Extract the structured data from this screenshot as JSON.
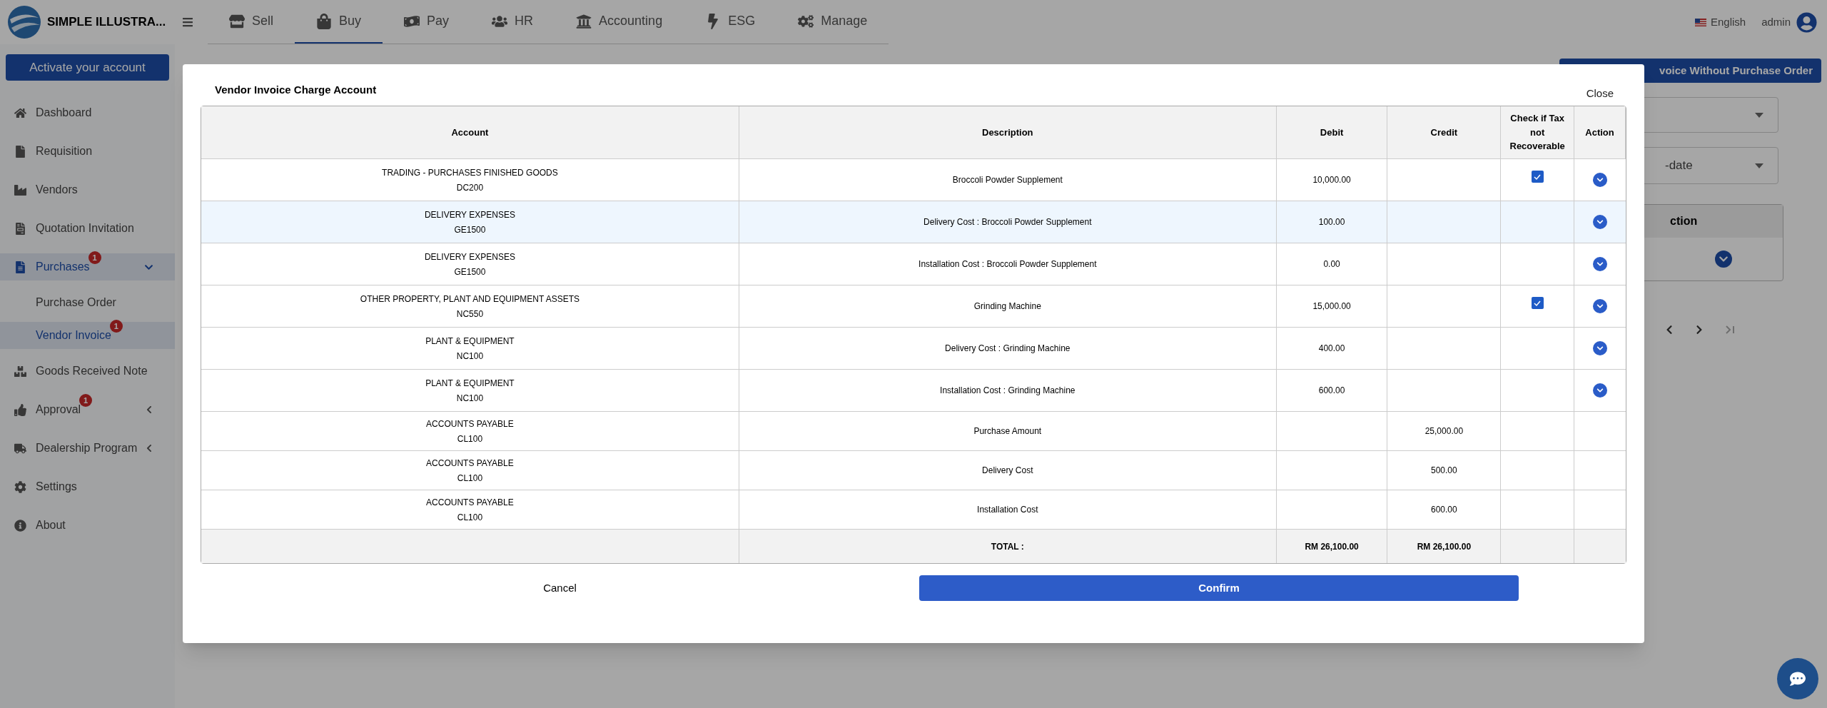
{
  "header": {
    "brand": "SIMPLE ILLUSTRA...",
    "nav_tabs": [
      {
        "label": "Sell",
        "selected": false
      },
      {
        "label": "Buy",
        "selected": true
      },
      {
        "label": "Pay",
        "selected": false
      },
      {
        "label": "HR",
        "selected": false
      },
      {
        "label": "Accounting",
        "selected": false
      },
      {
        "label": "ESG",
        "selected": false
      },
      {
        "label": "Manage",
        "selected": false
      }
    ],
    "language": "English",
    "user": "admin"
  },
  "sidebar": {
    "activate_button": "Activate your account",
    "items": [
      {
        "label": "Dashboard",
        "selected": false
      },
      {
        "label": "Requisition",
        "selected": false
      },
      {
        "label": "Vendors",
        "selected": false
      },
      {
        "label": "Quotation Invitation",
        "selected": false
      },
      {
        "label": "Purchases",
        "selected": true,
        "badge": "1",
        "expanded": true,
        "children": [
          {
            "label": "Purchase Order",
            "selected": false
          },
          {
            "label": "Vendor Invoice",
            "selected": true,
            "badge": "1"
          }
        ]
      },
      {
        "label": "Goods Received Note",
        "selected": false
      },
      {
        "label": "Approval",
        "selected": false,
        "badge": "1",
        "expanded": false
      },
      {
        "label": "Dealership Program",
        "selected": false,
        "expanded": false
      },
      {
        "label": "Settings",
        "selected": false
      },
      {
        "label": "About",
        "selected": false
      }
    ]
  },
  "background": {
    "primary_button": "voice Without Purchase Order",
    "select_2_value": "-date",
    "table_header": "ction"
  },
  "modal": {
    "title": "Vendor Invoice Charge Account",
    "close": "Close",
    "columns": [
      "Account",
      "Description",
      "Debit",
      "Credit",
      "Check if Tax not Recoverable",
      "Action"
    ],
    "rows": [
      {
        "account": "TRADING - PURCHASES FINISHED GOODS",
        "code": "DC200",
        "description": "Broccoli Powder Supplement",
        "debit": "10,000.00",
        "credit": "",
        "tax_not_recoverable": true,
        "highlighted": false,
        "has_action": true
      },
      {
        "account": "DELIVERY EXPENSES",
        "code": "GE1500",
        "description": "Delivery Cost : Broccoli Powder Supplement",
        "debit": "100.00",
        "credit": "",
        "tax_not_recoverable": false,
        "highlighted": true,
        "has_action": true
      },
      {
        "account": "DELIVERY EXPENSES",
        "code": "GE1500",
        "description": "Installation Cost : Broccoli Powder Supplement",
        "debit": "0.00",
        "credit": "",
        "tax_not_recoverable": false,
        "highlighted": false,
        "has_action": true
      },
      {
        "account": "OTHER PROPERTY, PLANT AND EQUIPMENT ASSETS",
        "code": "NC550",
        "description": "Grinding Machine",
        "debit": "15,000.00",
        "credit": "",
        "tax_not_recoverable": true,
        "highlighted": false,
        "has_action": true
      },
      {
        "account": "PLANT & EQUIPMENT",
        "code": "NC100",
        "description": "Delivery Cost : Grinding Machine",
        "debit": "400.00",
        "credit": "",
        "tax_not_recoverable": false,
        "highlighted": false,
        "has_action": true
      },
      {
        "account": "PLANT & EQUIPMENT",
        "code": "NC100",
        "description": "Installation Cost : Grinding Machine",
        "debit": "600.00",
        "credit": "",
        "tax_not_recoverable": false,
        "highlighted": false,
        "has_action": true
      },
      {
        "account": "ACCOUNTS PAYABLE",
        "code": "CL100",
        "description": "Purchase Amount",
        "debit": "",
        "credit": "25,000.00",
        "tax_not_recoverable": false,
        "highlighted": false,
        "has_action": false
      },
      {
        "account": "ACCOUNTS PAYABLE",
        "code": "CL100",
        "description": "Delivery Cost",
        "debit": "",
        "credit": "500.00",
        "tax_not_recoverable": false,
        "highlighted": false,
        "has_action": false
      },
      {
        "account": "ACCOUNTS PAYABLE",
        "code": "CL100",
        "description": "Installation Cost",
        "debit": "",
        "credit": "600.00",
        "tax_not_recoverable": false,
        "highlighted": false,
        "has_action": false
      }
    ],
    "total": {
      "label": "TOTAL :",
      "debit": "RM 26,100.00",
      "credit": "RM 26,100.00"
    },
    "cancel": "Cancel",
    "confirm": "Confirm"
  }
}
